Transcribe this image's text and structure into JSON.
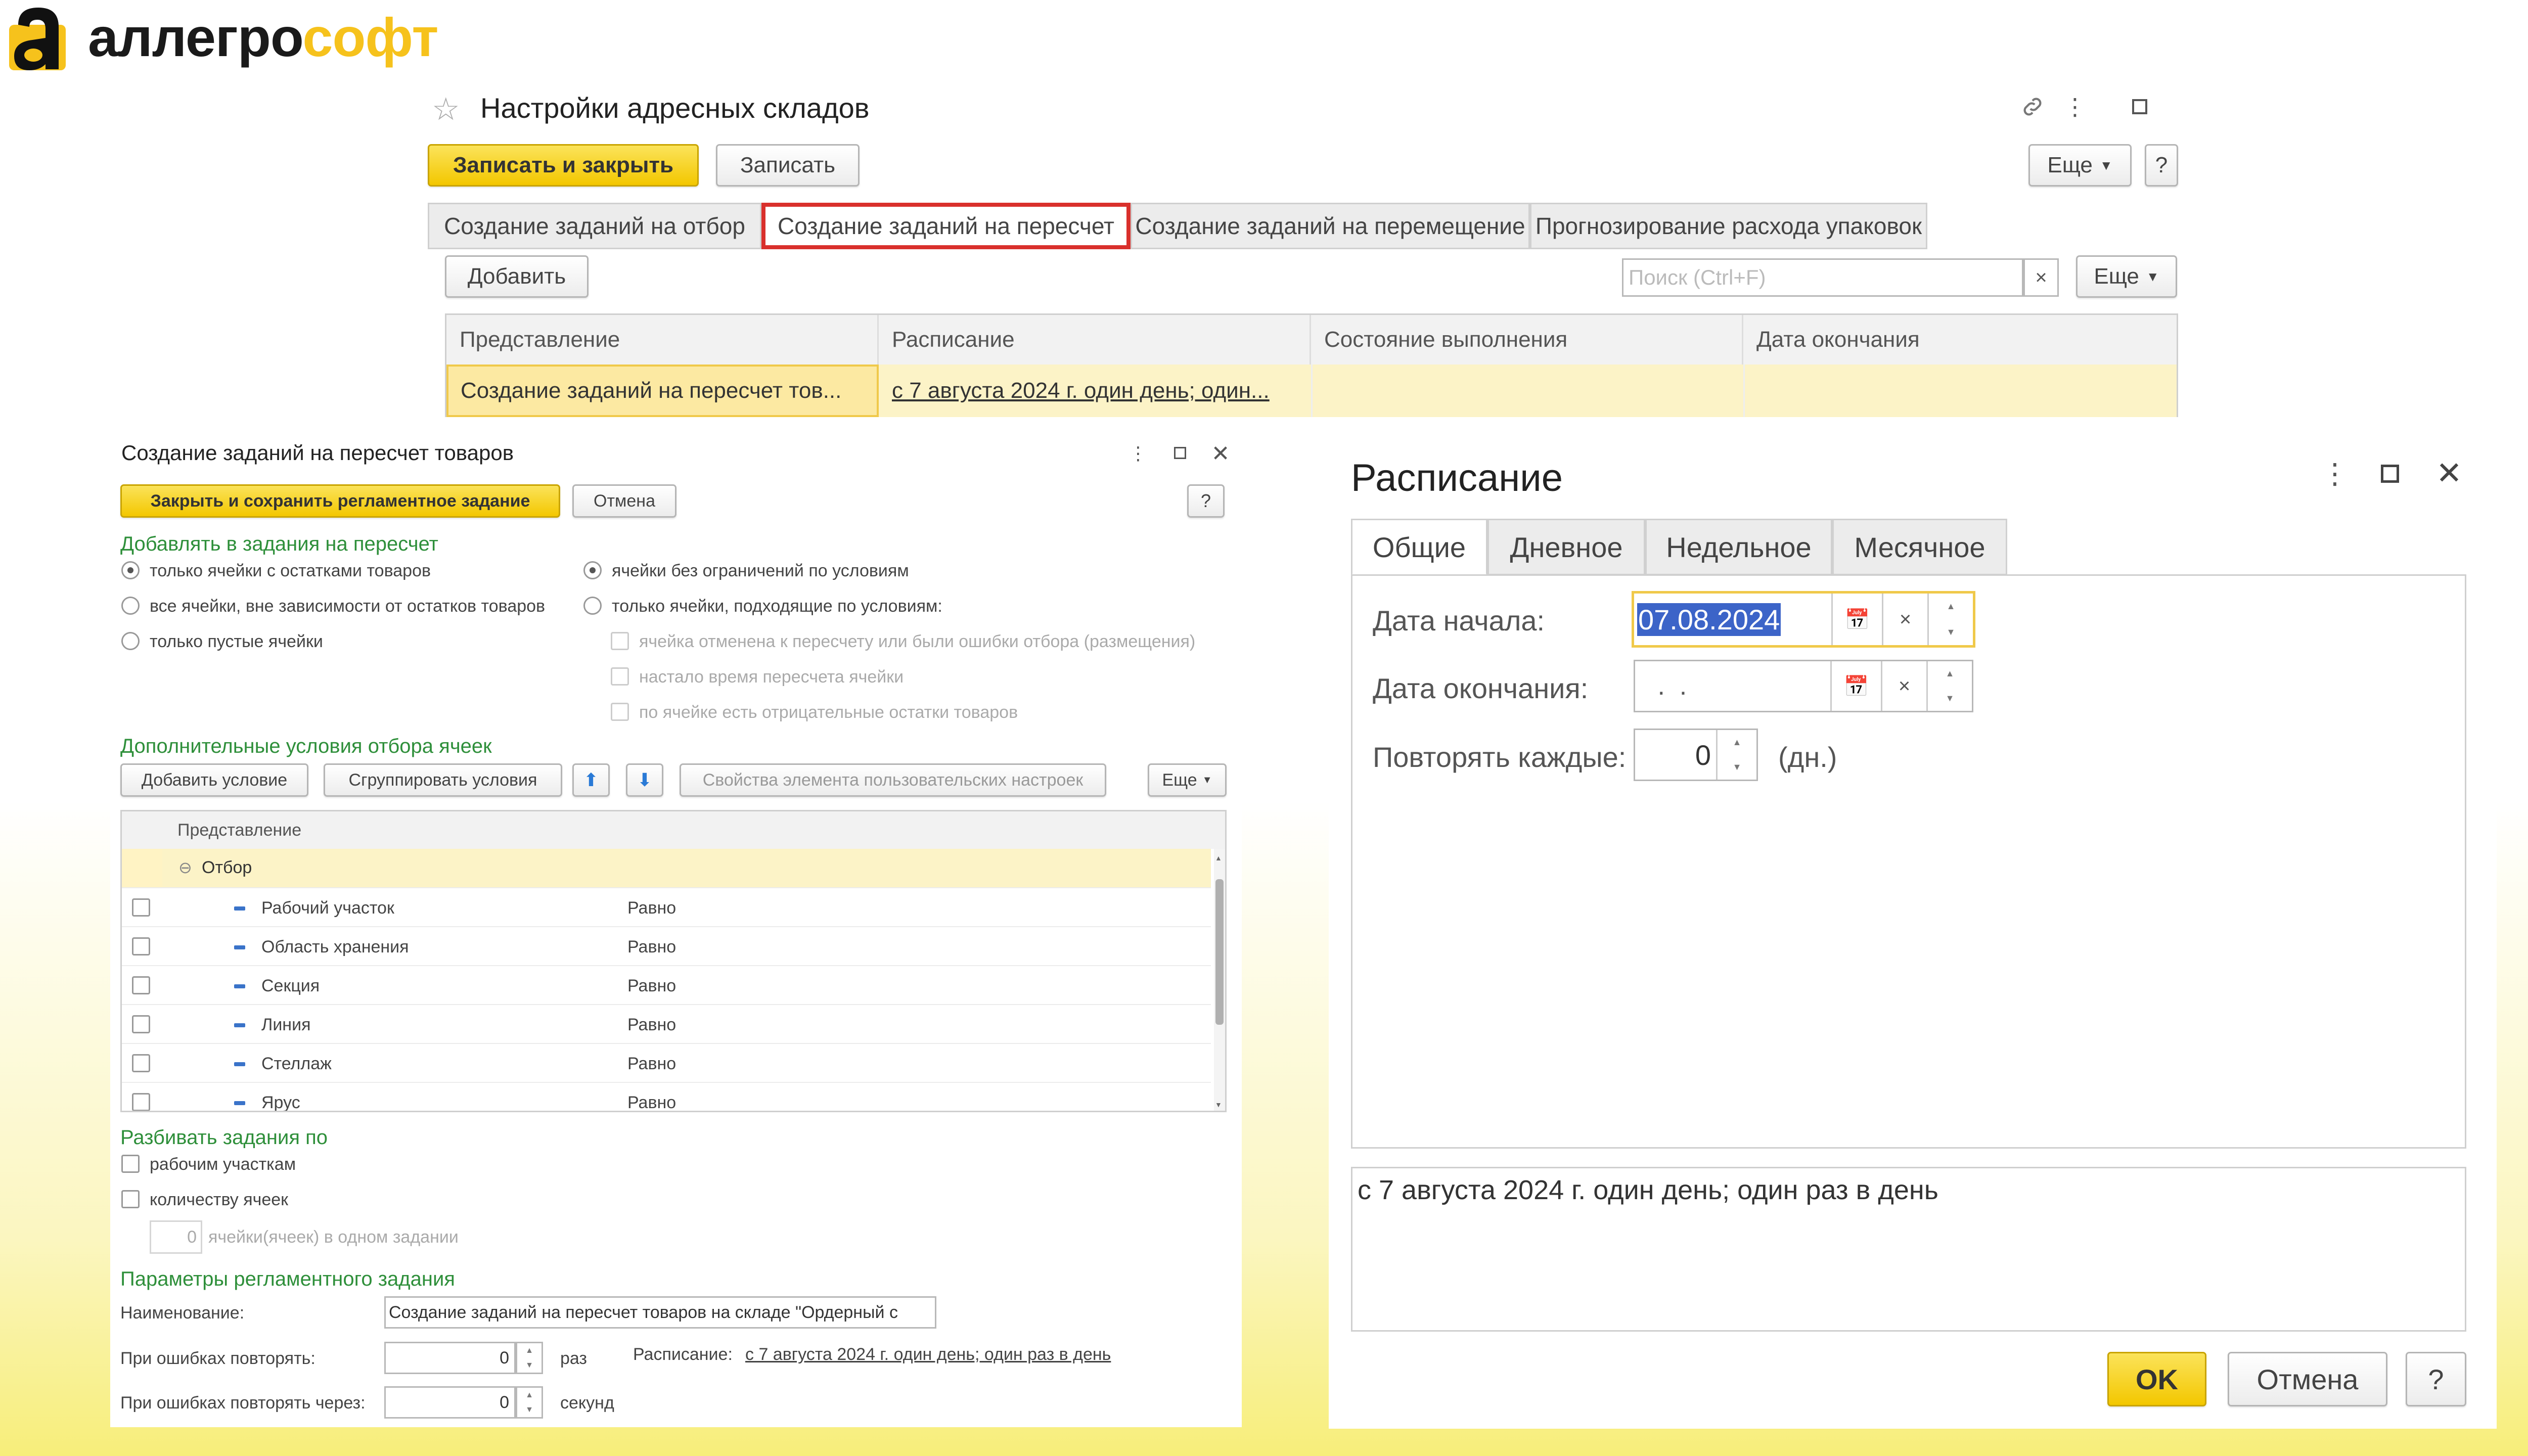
{
  "logo": {
    "part1": "аллегро",
    "part2": "софт"
  },
  "settings_window": {
    "title": "Настройки адресных складов",
    "save_close": "Записать и закрыть",
    "save": "Записать",
    "more": "Еще",
    "help": "?",
    "tabs": [
      "Создание заданий на отбор",
      "Создание заданий на пересчет",
      "Создание заданий на перемещение",
      "Прогнозирование расхода упаковок"
    ],
    "add": "Добавить",
    "search_placeholder": "Поиск (Ctrl+F)",
    "search_clear": "×",
    "more2": "Еще",
    "columns": [
      "Представление",
      "Расписание",
      "Состояние выполнения",
      "Дата окончания"
    ],
    "row": {
      "name": "Создание заданий на пересчет тов...",
      "schedule": "с 7 августа 2024 г. один день; один...",
      "state": "",
      "end": ""
    },
    "highlight_color": "#d9302c"
  },
  "task_window": {
    "title": "Создание заданий на пересчет товаров",
    "close_save": "Закрыть и сохранить регламентное задание",
    "cancel": "Отмена",
    "help": "?",
    "section1": "Добавлять в задания на пересчет",
    "radio_left": [
      "только ячейки с остатками товаров",
      "все ячейки, вне зависимости от остатков товаров",
      "только пустые ячейки"
    ],
    "radio_right": [
      "ячейки без ограничений по условиям",
      "только ячейки, подходящие по условиям:"
    ],
    "cond_checks": [
      "ячейка отменена к пересчету или были ошибки отбора (размещения)",
      "настало время пересчета ячейки",
      "по ячейке есть отрицательные остатки товаров"
    ],
    "section2": "Дополнительные условия отбора ячеек",
    "add_condition": "Добавить условие",
    "group_conditions": "Сгруппировать условия",
    "properties": "Свойства элемента пользовательских настроек",
    "more": "Еще",
    "grid_header": "Представление",
    "group_row": "Отбор",
    "filter_rows": [
      {
        "name": "Рабочий участок",
        "op": "Равно"
      },
      {
        "name": "Область хранения",
        "op": "Равно"
      },
      {
        "name": "Секция",
        "op": "Равно"
      },
      {
        "name": "Линия",
        "op": "Равно"
      },
      {
        "name": "Стеллаж",
        "op": "Равно"
      },
      {
        "name": "Ярус",
        "op": "Равно"
      }
    ],
    "section3": "Разбивать задания по",
    "split_checks": [
      "рабочим участкам",
      "количеству ячеек"
    ],
    "cells_value": "0",
    "cells_label": "ячейки(ячеек) в одном задании",
    "section4": "Параметры регламентного задания",
    "name_label": "Наименование:",
    "name_value": "Создание заданий на пересчет товаров на складе \"Ордерный с",
    "retry_label": "При ошибках повторять:",
    "retry_value": "0",
    "retry_unit": "раз",
    "schedule_label": "Расписание:",
    "schedule_link": "с 7 августа 2024 г. один день; один раз в день",
    "retry_after_label": "При ошибках повторять через:",
    "retry_after_value": "0",
    "retry_after_unit": "секунд"
  },
  "schedule_dialog": {
    "title": "Расписание",
    "tabs": [
      "Общие",
      "Дневное",
      "Недельное",
      "Месячное"
    ],
    "start_label": "Дата начала:",
    "start_value": "07.08.2024",
    "end_label": "Дата окончания:",
    "end_value": " .  .",
    "repeat_label": "Повторять каждые:",
    "repeat_value": "0",
    "repeat_unit": "(дн.)",
    "summary": "с 7 августа 2024 г. один день; один раз в день",
    "ok": "OK",
    "cancel": "Отмена",
    "help": "?"
  }
}
